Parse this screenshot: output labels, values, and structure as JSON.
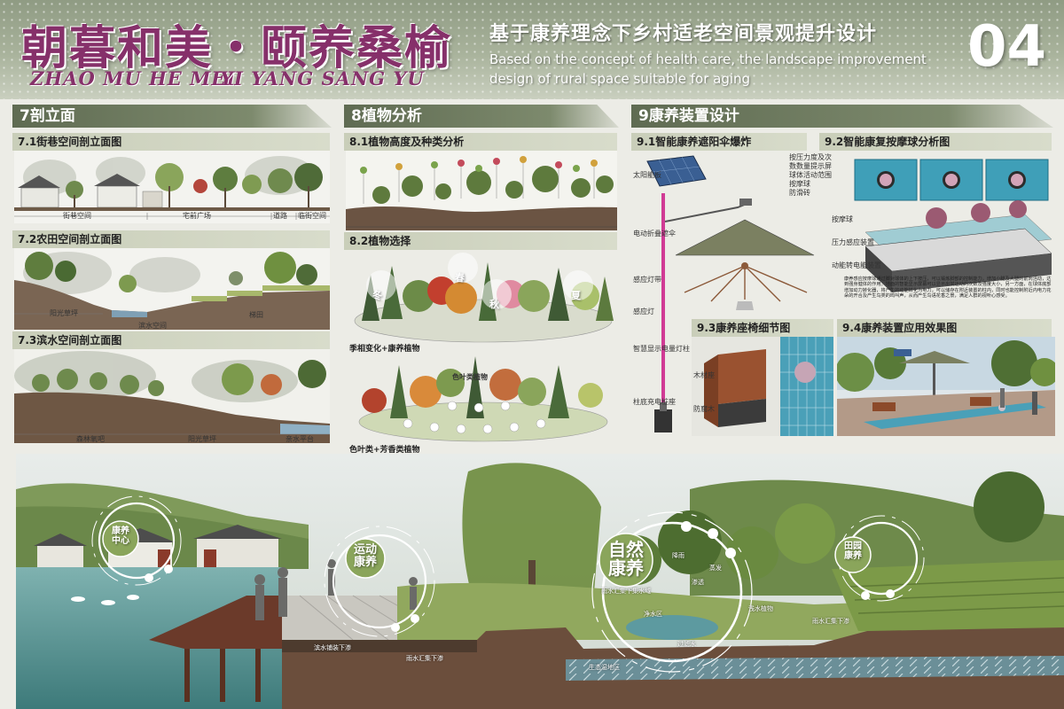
{
  "header": {
    "title_cn": "朝暮和美・颐养桑榆",
    "title_en_1": "ZHAO MU HE MEI",
    "title_en_2": "YI YANG SANG YU",
    "subtitle_cn": "基于康养理念下乡村适老空间景观提升设计",
    "subtitle_en": "Based on the concept of health care, the landscape improvement design of rural space suitable for aging",
    "page_number": "04"
  },
  "section7": {
    "title": "7剖立面",
    "s71": {
      "title": "7.1街巷空间剖立面图",
      "labels": [
        "街巷空间",
        "宅前广场",
        "道路",
        "临街空间"
      ]
    },
    "s72": {
      "title": "7.2农田空间剖立面图",
      "labels": [
        "阳光草坪",
        "滨水空间",
        "梯田"
      ]
    },
    "s73": {
      "title": "7.3滨水空间剖立面图",
      "labels": [
        "森林氧吧",
        "阳光草坪",
        "亲水平台"
      ]
    }
  },
  "section8": {
    "title": "8植物分析",
    "s81": {
      "title": "8.1植物高度及种类分析"
    },
    "s82": {
      "title": "8.2植物选择",
      "seasons": [
        "冬",
        "春",
        "秋",
        "夏"
      ],
      "caption1": "季相变化+康养植物",
      "mid_label": "色叶类植物",
      "caption2": "色叶类+芳香类植物"
    }
  },
  "section9": {
    "title": "9康养装置设计",
    "s91": {
      "title": "9.1智能康养遮阳伞爆炸",
      "labels": [
        "太阳能板",
        "电动折叠遮伞",
        "感应灯带",
        "感应灯",
        "智慧显示电量灯柱",
        "柱底充电桩座"
      ]
    },
    "s92": {
      "title": "9.2智能康复按摩球分析图",
      "labels": [
        "按压力度及次",
        "数数量提示屏",
        "球体活动范围",
        "按摩球",
        "防滑砖",
        "按摩球",
        "压力感应装置",
        "动能转电能装置"
      ],
      "description": "康养感应按摩球通过脚对球体的上下按压，可以锻炼脚部的控制能力，增加小腿及大腿的前肉活动，达到强身健体的作用。地面的智能显示屏幕可以显示出其运动的次数及强度大小，另一方面，在球体底部增加动力转化器，将产生的动能转化为电力，可以储存在附近装置的柱内，同时也能控制附近内电力花朵的开合及产生鸟类的鸣叫声，从而产生鸟语花香之景，满足人群的视听心感受。"
    },
    "s93": {
      "title": "9.3康养座椅细节图",
      "labels": [
        "木材座",
        "防腐木"
      ]
    },
    "s94": {
      "title": "9.4康养装置应用效果图"
    }
  },
  "panorama": {
    "rings": [
      "康养中心",
      "运动康养",
      "自然康养",
      "田园康养"
    ],
    "labels": [
      "滨水铺装下渗",
      "雨水汇集下集水域",
      "渗透",
      "净水区",
      "生态湿地区",
      "雨水汇集下渗",
      "浅水植物",
      "过滤水",
      "雨水汇集下渗",
      "蒸发",
      "降雨"
    ]
  },
  "colors": {
    "accent": "#86306a",
    "banner": "#6b7760",
    "sage": "#a9b39c"
  }
}
